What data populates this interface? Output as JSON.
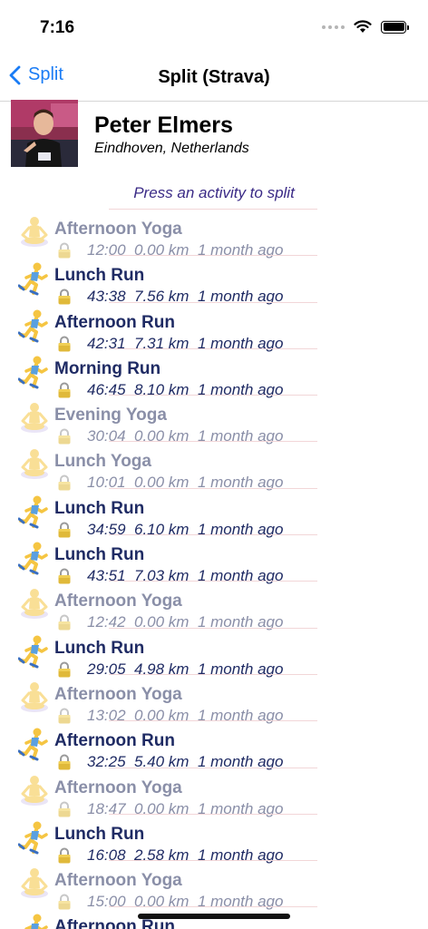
{
  "status": {
    "time": "7:16"
  },
  "nav": {
    "back_label": "Split",
    "title": "Split (Strava)"
  },
  "profile": {
    "name": "Peter Elmers",
    "location": "Eindhoven, Netherlands"
  },
  "hint": "Press an activity to split",
  "activities": [
    {
      "name": "Afternoon Yoga",
      "duration": "12:00",
      "distance": "0.00 km",
      "when": "1 month ago",
      "type": "yoga"
    },
    {
      "name": "Lunch Run",
      "duration": "43:38",
      "distance": "7.56 km",
      "when": "1 month ago",
      "type": "run"
    },
    {
      "name": "Afternoon Run",
      "duration": "42:31",
      "distance": "7.31 km",
      "when": "1 month ago",
      "type": "run"
    },
    {
      "name": "Morning Run",
      "duration": "46:45",
      "distance": "8.10 km",
      "when": "1 month ago",
      "type": "run"
    },
    {
      "name": "Evening Yoga",
      "duration": "30:04",
      "distance": "0.00 km",
      "when": "1 month ago",
      "type": "yoga"
    },
    {
      "name": "Lunch Yoga",
      "duration": "10:01",
      "distance": "0.00 km",
      "when": "1 month ago",
      "type": "yoga"
    },
    {
      "name": "Lunch Run",
      "duration": "34:59",
      "distance": "6.10 km",
      "when": "1 month ago",
      "type": "run"
    },
    {
      "name": "Lunch Run",
      "duration": "43:51",
      "distance": "7.03 km",
      "when": "1 month ago",
      "type": "run"
    },
    {
      "name": "Afternoon Yoga",
      "duration": "12:42",
      "distance": "0.00 km",
      "when": "1 month ago",
      "type": "yoga"
    },
    {
      "name": "Lunch Run",
      "duration": "29:05",
      "distance": "4.98 km",
      "when": "1 month ago",
      "type": "run"
    },
    {
      "name": "Afternoon Yoga",
      "duration": "13:02",
      "distance": "0.00 km",
      "when": "1 month ago",
      "type": "yoga"
    },
    {
      "name": "Afternoon Run",
      "duration": "32:25",
      "distance": "5.40 km",
      "when": "1 month ago",
      "type": "run"
    },
    {
      "name": "Afternoon Yoga",
      "duration": "18:47",
      "distance": "0.00 km",
      "when": "1 month ago",
      "type": "yoga"
    },
    {
      "name": "Lunch Run",
      "duration": "16:08",
      "distance": "2.58 km",
      "when": "1 month ago",
      "type": "run"
    },
    {
      "name": "Afternoon Yoga",
      "duration": "15:00",
      "distance": "0.00 km",
      "when": "1 month ago",
      "type": "yoga"
    },
    {
      "name": "Afternoon Run",
      "duration": "",
      "distance": "",
      "when": "",
      "type": "run"
    }
  ],
  "icons": {
    "run": "runner-icon",
    "yoga": "yoga-icon",
    "lock": "lock-icon"
  },
  "colors": {
    "accent": "#1a7cf5",
    "run_text": "#1f2b64",
    "yoga_text": "#8a8fa8",
    "hint": "#3a2a86"
  }
}
